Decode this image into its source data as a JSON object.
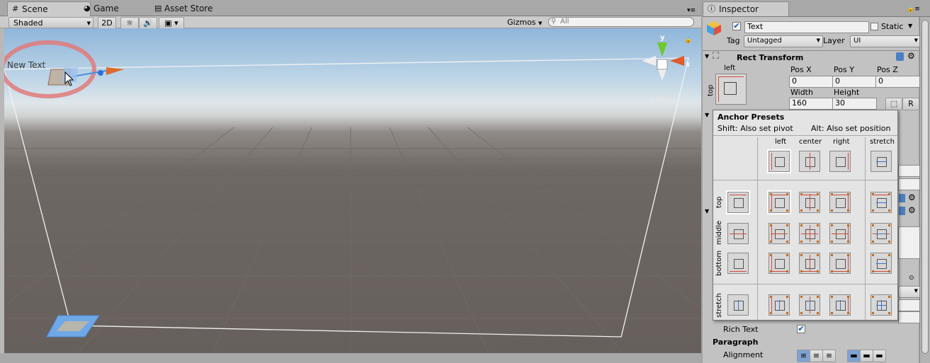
{
  "scene_tabs": [
    {
      "label": "Scene"
    },
    {
      "label": "Game"
    },
    {
      "label": "Asset Store"
    }
  ],
  "scene_toolbar": {
    "shading": "Shaded",
    "mode2d": "2D",
    "gizmos": "Gizmos",
    "search_placeholder": "All"
  },
  "scene": {
    "object_label": "New Text",
    "camera_mode": "Persp",
    "axes": {
      "y": "y",
      "x": "x"
    }
  },
  "inspector": {
    "tab": "Inspector",
    "object": {
      "name": "Text",
      "active": true,
      "static_label": "Static"
    },
    "tag_label": "Tag",
    "tag_value": "Untagged",
    "layer_label": "Layer",
    "layer_value": "UI",
    "rect_transform": {
      "title": "Rect Transform",
      "anchor_h": "left",
      "anchor_v": "top",
      "pos_x_label": "Pos X",
      "pos_y_label": "Pos Y",
      "pos_z_label": "Pos Z",
      "pos_x": "0",
      "pos_y": "0",
      "pos_z": "0",
      "width_label": "Width",
      "height_label": "Height",
      "width": "160",
      "height": "30",
      "r_button": "R"
    },
    "rich_text_label": "Rich Text",
    "rich_text_checked": true,
    "paragraph_label": "Paragraph",
    "alignment_label": "Alignment"
  },
  "anchor_presets": {
    "title": "Anchor Presets",
    "hint_shift": "Shift: Also set pivot",
    "hint_alt": "Alt: Also set position",
    "columns": [
      "left",
      "center",
      "right",
      "stretch"
    ],
    "rows": [
      "top",
      "middle",
      "bottom",
      "stretch"
    ]
  },
  "colors": {
    "accent_red": "#d14a3a",
    "accent_blue": "#3f73c8",
    "highlight_circle": "#e07a7a"
  }
}
